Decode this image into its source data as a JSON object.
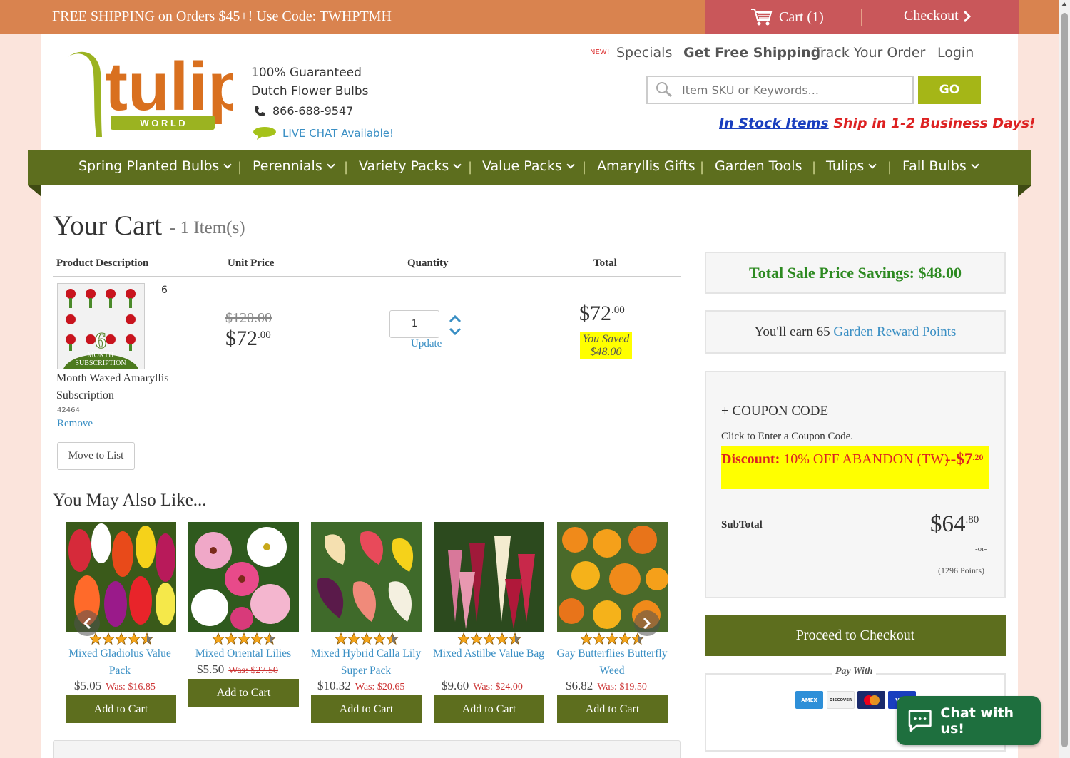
{
  "promo": {
    "text": "FREE SHIPPING on Orders $45+! Use Code: TWHPTMH",
    "cart": "Cart (1)",
    "checkout": "Checkout"
  },
  "header": {
    "logo_word": "tulip",
    "logo_sub": "W O R L D",
    "tagline_1": "100% Guaranteed",
    "tagline_2": "Dutch Flower Bulbs",
    "phone": "866-688-9547",
    "live_chat": "LIVE CHAT Available!",
    "new_badge": "NEW!",
    "links": [
      "Specials",
      "Get Free Shipping",
      "Track Your Order",
      "Login"
    ],
    "search_placeholder": "Item SKU or Keywords...",
    "go": "GO",
    "instock_link": "In Stock Items",
    "instock_text": " Ship in 1-2 Business Days!"
  },
  "nav": [
    "Spring Planted Bulbs",
    "Perennials",
    "Variety Packs",
    "Value Packs",
    "Amaryllis Gifts",
    "Garden Tools",
    "Tulips",
    "Fall Bulbs"
  ],
  "cart": {
    "title": "Your Cart",
    "count": " - 1 Item(s)",
    "headers": [
      "Product Description",
      "Unit Price",
      "Quantity",
      "Total"
    ],
    "item": {
      "img_number": "6",
      "img_caption_1": "MONTH",
      "img_caption_2": "SUBSCRIPTION",
      "qty_mark": "6",
      "name": "Month Waxed Amaryllis Subscription",
      "sku": "42464",
      "remove": "Remove",
      "move": "Move to List",
      "was": "$120.00",
      "price_main": "$72",
      "price_cents": ".00",
      "quantity": "1",
      "update": "Update",
      "total_main": "$72",
      "total_cents": ".00",
      "saved_1": "You Saved",
      "saved_2": "$48.00"
    }
  },
  "sidebar": {
    "savings": "Total Sale Price Savings: $48.00",
    "reward_pre": "You'll earn 65 ",
    "reward_link": "Garden Reward Points",
    "coupon_head": "+ COUPON CODE",
    "coupon_click": "Click to Enter a Coupon Code.",
    "discount_label": "Discount:",
    "discount_text": " 10% OFF ABANDON (TW)",
    "discount_amt_main": "--$7",
    "discount_amt_cents": ".20",
    "subtotal_label": "SubTotal",
    "subtotal_main": "$64",
    "subtotal_cents": ".80",
    "or": "-or-",
    "points": "(1296 Points)",
    "proceed": "Proceed to Checkout",
    "pay_with": "Pay With",
    "cards": [
      "AMEX",
      "DISCOVER",
      "",
      "VISA"
    ],
    "chat": "Chat with us!"
  },
  "also": {
    "title": "You May Also Like...",
    "items": [
      {
        "name": "Mixed Gladiolus Value Pack",
        "price": "$5.05",
        "was": "Was: $16.85",
        "add": "Add to Cart",
        "rating": 4.5
      },
      {
        "name": "Mixed Oriental Lilies",
        "price": "$5.50",
        "was": "Was: $27.50",
        "add": "Add to Cart",
        "rating": 4.5
      },
      {
        "name": "Mixed Hybrid Calla Lily Super Pack",
        "price": "$10.32",
        "was": "Was: $20.65",
        "add": "Add to Cart",
        "rating": 4.5
      },
      {
        "name": "Mixed Astilbe Value Bag",
        "price": "$9.60",
        "was": "Was: $24.00",
        "add": "Add to Cart",
        "rating": 4.5
      },
      {
        "name": "Gay Butterflies Butterfly Weed",
        "price": "$6.82",
        "was": "Was: $19.50",
        "add": "Add to Cart",
        "rating": 4.5
      }
    ]
  },
  "colors": {
    "promo": "#d9834f",
    "cart_bar": "#c9575a",
    "nav_green": "#5d6e1e",
    "go_green": "#a5b617",
    "savings_green": "#2d8a21",
    "link_blue": "#3a8fc4"
  }
}
